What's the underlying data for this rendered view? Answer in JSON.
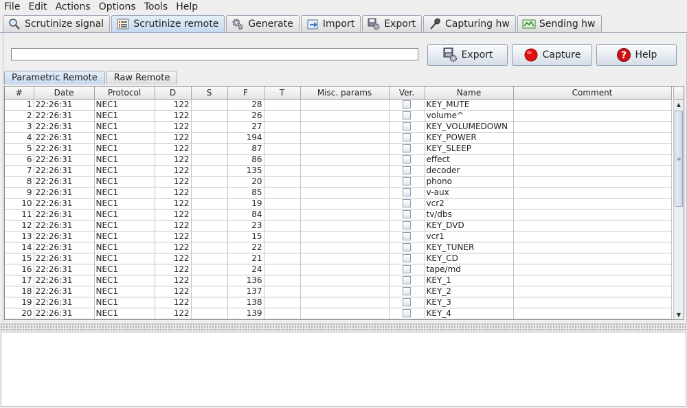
{
  "menu": [
    {
      "label": "File"
    },
    {
      "label": "Edit"
    },
    {
      "label": "Actions"
    },
    {
      "label": "Options"
    },
    {
      "label": "Tools"
    },
    {
      "label": "Help"
    }
  ],
  "main_tabs": [
    {
      "label": "Scrutinize signal",
      "icon": "magnifier-icon",
      "active": false
    },
    {
      "label": "Scrutinize remote",
      "icon": "list-icon",
      "active": true
    },
    {
      "label": "Generate",
      "icon": "gears-icon",
      "active": false
    },
    {
      "label": "Import",
      "icon": "import-icon",
      "active": false
    },
    {
      "label": "Export",
      "icon": "export-icon",
      "active": false
    },
    {
      "label": "Capturing hw",
      "icon": "microphone-icon",
      "active": false
    },
    {
      "label": "Sending hw",
      "icon": "sending-icon",
      "active": false
    }
  ],
  "toolbar": {
    "decode_value": "",
    "export_label": "Export",
    "capture_label": "Capture",
    "help_label": "Help"
  },
  "sub_tabs": [
    {
      "label": "Parametric Remote",
      "active": true
    },
    {
      "label": "Raw Remote",
      "active": false
    }
  ],
  "table": {
    "columns": [
      "#",
      "Date",
      "Protocol",
      "D",
      "S",
      "F",
      "T",
      "Misc. params",
      "Ver.",
      "Name",
      "Comment"
    ],
    "rows": [
      {
        "n": "1",
        "date": "22:26:31",
        "protocol": "NEC1",
        "d": "122",
        "s": "",
        "f": "28",
        "t": "",
        "misc": "",
        "ver": false,
        "name": "KEY_MUTE",
        "comment": ""
      },
      {
        "n": "2",
        "date": "22:26:31",
        "protocol": "NEC1",
        "d": "122",
        "s": "",
        "f": "26",
        "t": "",
        "misc": "",
        "ver": false,
        "name": "volume^",
        "comment": ""
      },
      {
        "n": "3",
        "date": "22:26:31",
        "protocol": "NEC1",
        "d": "122",
        "s": "",
        "f": "27",
        "t": "",
        "misc": "",
        "ver": false,
        "name": "KEY_VOLUMEDOWN",
        "comment": ""
      },
      {
        "n": "4",
        "date": "22:26:31",
        "protocol": "NEC1",
        "d": "122",
        "s": "",
        "f": "194",
        "t": "",
        "misc": "",
        "ver": false,
        "name": "KEY_POWER",
        "comment": ""
      },
      {
        "n": "5",
        "date": "22:26:31",
        "protocol": "NEC1",
        "d": "122",
        "s": "",
        "f": "87",
        "t": "",
        "misc": "",
        "ver": false,
        "name": "KEY_SLEEP",
        "comment": ""
      },
      {
        "n": "6",
        "date": "22:26:31",
        "protocol": "NEC1",
        "d": "122",
        "s": "",
        "f": "86",
        "t": "",
        "misc": "",
        "ver": false,
        "name": "effect",
        "comment": ""
      },
      {
        "n": "7",
        "date": "22:26:31",
        "protocol": "NEC1",
        "d": "122",
        "s": "",
        "f": "135",
        "t": "",
        "misc": "",
        "ver": false,
        "name": "decoder",
        "comment": ""
      },
      {
        "n": "8",
        "date": "22:26:31",
        "protocol": "NEC1",
        "d": "122",
        "s": "",
        "f": "20",
        "t": "",
        "misc": "",
        "ver": false,
        "name": "phono",
        "comment": ""
      },
      {
        "n": "9",
        "date": "22:26:31",
        "protocol": "NEC1",
        "d": "122",
        "s": "",
        "f": "85",
        "t": "",
        "misc": "",
        "ver": false,
        "name": "v-aux",
        "comment": ""
      },
      {
        "n": "10",
        "date": "22:26:31",
        "protocol": "NEC1",
        "d": "122",
        "s": "",
        "f": "19",
        "t": "",
        "misc": "",
        "ver": false,
        "name": "vcr2",
        "comment": ""
      },
      {
        "n": "11",
        "date": "22:26:31",
        "protocol": "NEC1",
        "d": "122",
        "s": "",
        "f": "84",
        "t": "",
        "misc": "",
        "ver": false,
        "name": "tv/dbs",
        "comment": ""
      },
      {
        "n": "12",
        "date": "22:26:31",
        "protocol": "NEC1",
        "d": "122",
        "s": "",
        "f": "23",
        "t": "",
        "misc": "",
        "ver": false,
        "name": "KEY_DVD",
        "comment": ""
      },
      {
        "n": "13",
        "date": "22:26:31",
        "protocol": "NEC1",
        "d": "122",
        "s": "",
        "f": "15",
        "t": "",
        "misc": "",
        "ver": false,
        "name": "vcr1",
        "comment": ""
      },
      {
        "n": "14",
        "date": "22:26:31",
        "protocol": "NEC1",
        "d": "122",
        "s": "",
        "f": "22",
        "t": "",
        "misc": "",
        "ver": false,
        "name": "KEY_TUNER",
        "comment": ""
      },
      {
        "n": "15",
        "date": "22:26:31",
        "protocol": "NEC1",
        "d": "122",
        "s": "",
        "f": "21",
        "t": "",
        "misc": "",
        "ver": false,
        "name": "KEY_CD",
        "comment": ""
      },
      {
        "n": "16",
        "date": "22:26:31",
        "protocol": "NEC1",
        "d": "122",
        "s": "",
        "f": "24",
        "t": "",
        "misc": "",
        "ver": false,
        "name": "tape/md",
        "comment": ""
      },
      {
        "n": "17",
        "date": "22:26:31",
        "protocol": "NEC1",
        "d": "122",
        "s": "",
        "f": "136",
        "t": "",
        "misc": "",
        "ver": false,
        "name": "KEY_1",
        "comment": ""
      },
      {
        "n": "18",
        "date": "22:26:31",
        "protocol": "NEC1",
        "d": "122",
        "s": "",
        "f": "137",
        "t": "",
        "misc": "",
        "ver": false,
        "name": "KEY_2",
        "comment": ""
      },
      {
        "n": "19",
        "date": "22:26:31",
        "protocol": "NEC1",
        "d": "122",
        "s": "",
        "f": "138",
        "t": "",
        "misc": "",
        "ver": false,
        "name": "KEY_3",
        "comment": ""
      },
      {
        "n": "20",
        "date": "22:26:31",
        "protocol": "NEC1",
        "d": "122",
        "s": "",
        "f": "139",
        "t": "",
        "misc": "",
        "ver": false,
        "name": "KEY_4",
        "comment": ""
      }
    ]
  },
  "console": {
    "text": ""
  },
  "colors": {
    "active_tab": "#c6d8ee",
    "tab_border": "#9aa7b7",
    "capture_red": "#e01010",
    "help_red": "#d01010"
  }
}
